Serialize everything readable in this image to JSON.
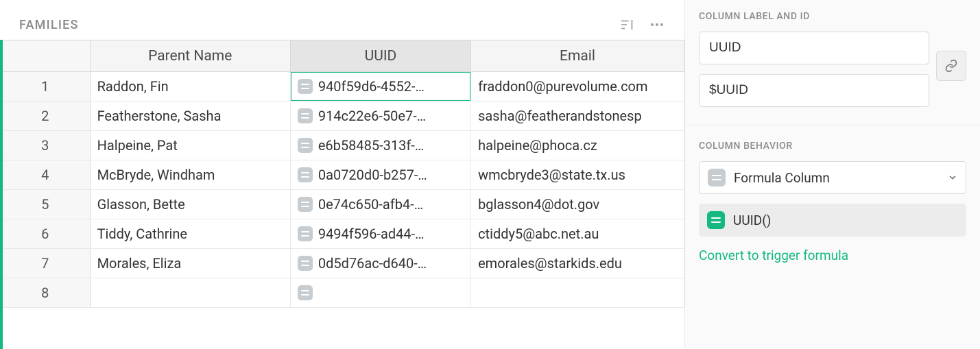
{
  "table": {
    "title": "FAMILIES",
    "columns": [
      "Parent Name",
      "UUID",
      "Email"
    ],
    "rows": [
      {
        "n": "1",
        "name": "Raddon, Fin",
        "uuid": "940f59d6-4552-…",
        "email": "fraddon0@purevolume.com"
      },
      {
        "n": "2",
        "name": "Featherstone, Sasha",
        "uuid": "914c22e6-50e7-…",
        "email": "sasha@featherandstonesp"
      },
      {
        "n": "3",
        "name": "Halpeine, Pat",
        "uuid": "e6b58485-313f-…",
        "email": "halpeine@phoca.cz"
      },
      {
        "n": "4",
        "name": "McBryde, Windham",
        "uuid": "0a0720d0-b257-…",
        "email": "wmcbryde3@state.tx.us"
      },
      {
        "n": "5",
        "name": "Glasson, Bette",
        "uuid": "0e74c650-afb4-…",
        "email": "bglasson4@dot.gov"
      },
      {
        "n": "6",
        "name": "Tiddy, Cathrine",
        "uuid": "9494f596-ad44-…",
        "email": "ctiddy5@abc.net.au"
      },
      {
        "n": "7",
        "name": "Morales, Eliza",
        "uuid": "0d5d76ac-d640-…",
        "email": "emorales@starkids.edu"
      },
      {
        "n": "8",
        "name": "",
        "uuid": "",
        "email": ""
      }
    ],
    "selected_cell": {
      "row": 0,
      "col": "uuid"
    }
  },
  "panel": {
    "section1_title": "COLUMN LABEL AND ID",
    "label_value": "UUID",
    "id_value": "$UUID",
    "section2_title": "COLUMN BEHAVIOR",
    "behavior_option": "Formula Column",
    "formula_text": "UUID()",
    "convert_link": "Convert to trigger formula"
  }
}
